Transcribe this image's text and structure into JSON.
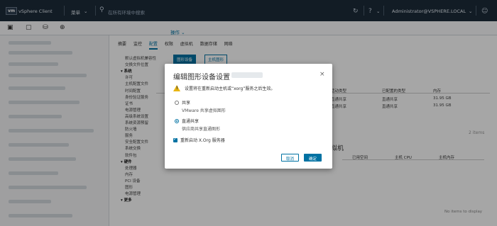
{
  "topbar": {
    "logo": "vm",
    "app": "vSphere Client",
    "menu": "菜单",
    "search_placeholder": "在所有环境中搜索",
    "user": "Administrator@VSPHERE.LOCAL"
  },
  "header": {
    "object_title": "",
    "actions": "操作",
    "tabs": [
      "摘要",
      "监控",
      "配置",
      "权限",
      "虚拟机",
      "数据存储",
      "网络"
    ],
    "active_tab": "配置"
  },
  "subnav": {
    "items": [
      {
        "label": "默认虚拟机兼容性",
        "section": false
      },
      {
        "label": "交换文件位置",
        "section": false
      },
      {
        "label": "▾ 系统",
        "section": true
      },
      {
        "label": "许可",
        "section": false
      },
      {
        "label": "主机配置文件",
        "section": false
      },
      {
        "label": "时间配置",
        "section": false
      },
      {
        "label": "身份验证服务",
        "section": false
      },
      {
        "label": "证书",
        "section": false
      },
      {
        "label": "电源管理",
        "section": false
      },
      {
        "label": "高级系统设置",
        "section": false
      },
      {
        "label": "系统资源预留",
        "section": false
      },
      {
        "label": "防火墙",
        "section": false
      },
      {
        "label": "服务",
        "section": false
      },
      {
        "label": "安全配置文件",
        "section": false
      },
      {
        "label": "系统交换",
        "section": false
      },
      {
        "label": "软件包",
        "section": false
      },
      {
        "label": "▾ 硬件",
        "section": true
      },
      {
        "label": "处理器",
        "section": false
      },
      {
        "label": "内存",
        "section": false
      },
      {
        "label": "PCI 设备",
        "section": false
      },
      {
        "label": "图形",
        "section": false
      },
      {
        "label": "电源管理",
        "section": false
      },
      {
        "label": "▾ 更多",
        "section": true
      }
    ]
  },
  "content": {
    "tabs": [
      "图形设备",
      "主机图形"
    ],
    "active_tab": "图形设备",
    "table": {
      "headers": [
        "活动类型",
        "已配置的类型",
        "内存"
      ],
      "rows": [
        [
          "直通共享",
          "直通共享",
          "31.95 GB"
        ],
        [
          "直通共享",
          "直通共享",
          "31.95 GB"
        ]
      ],
      "footer": "2 items"
    },
    "vm_section": {
      "title": "拟机",
      "headers": [
        "已用空间",
        "主机 CPU",
        "主机内存"
      ],
      "empty": "No items to display"
    }
  },
  "dialog": {
    "title": "编辑图形设备设置",
    "warning": "设置将在重新启动主机或“xorg”服务之后生效。",
    "option_shared": {
      "label": "共享",
      "desc": "VMware 共享虚拟图形"
    },
    "option_direct": {
      "label": "直通共享",
      "desc": "供应商共享直通图形"
    },
    "checkbox": "重新启动 X.Org 服务器",
    "cancel": "取消",
    "ok": "确定",
    "close": "×"
  }
}
